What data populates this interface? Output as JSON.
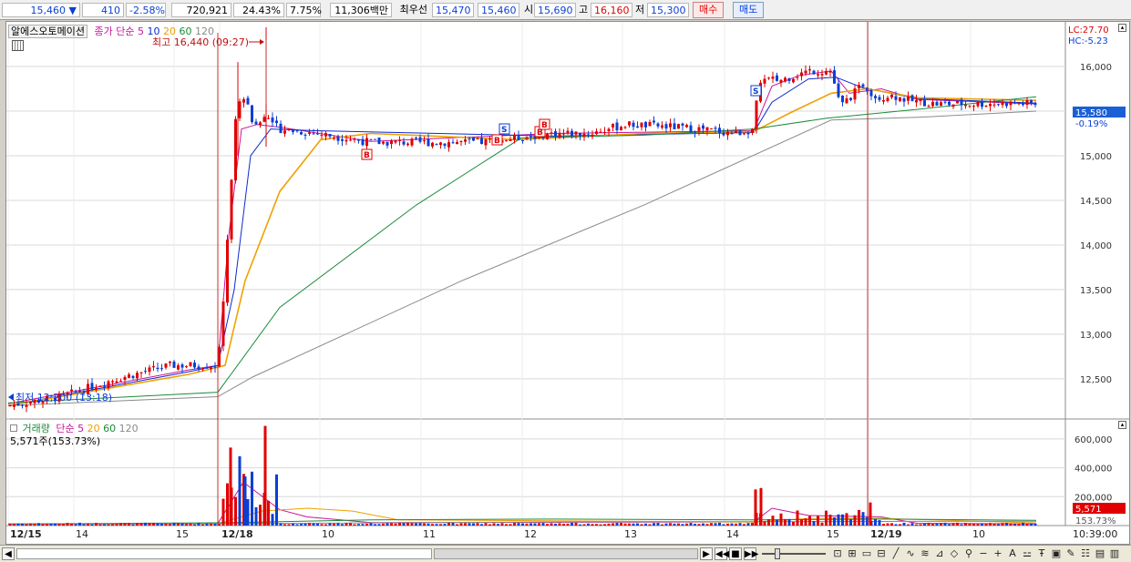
{
  "quote": {
    "price": "15,460",
    "direction": "▼",
    "change": "410",
    "change_pct": "-2.58%",
    "volume": "720,921",
    "turnover_rate": "24.43%",
    "ratio": "7.75%",
    "amount": "11,306백만",
    "best_bid_label": "최우선",
    "best_ask": "15,470",
    "best_bid": "15,460",
    "open_label": "시",
    "open": "15,690",
    "high_label": "고",
    "high": "16,160",
    "low_label": "저",
    "low": "15,300",
    "buy_button": "매수",
    "sell_button": "매도"
  },
  "price_pane": {
    "stock_name": "알에스오토메이션",
    "ma_title": "종가 단순",
    "ma_periods": [
      "5",
      "10",
      "20",
      "60",
      "120"
    ],
    "ma_colors": [
      "#c8149b",
      "#0a2bd0",
      "#f0a000",
      "#1a8c3a",
      "#8a8a8a"
    ],
    "high_annotation": "최고 16,440 (09:27)",
    "low_annotation": "최저 12,200 (13:18)",
    "lc_label": "LC:27.70",
    "hc_label": "HC:-5.23",
    "current_price_tag": "15,580",
    "current_change_tag": "-0.19%",
    "y_ticks": [
      "16,000",
      "15,500",
      "15,000",
      "14,500",
      "14,000",
      "13,500",
      "13,000",
      "12,500"
    ]
  },
  "volume_pane": {
    "title": "거래량",
    "ma_title": "단순",
    "ma_periods": [
      "5",
      "20",
      "60",
      "120"
    ],
    "ma_colors": [
      "#c8149b",
      "#f0a000",
      "#1a8c3a",
      "#8a8a8a"
    ],
    "current_volume": "5,571주(153.73%)",
    "y_ticks": [
      "600,000",
      "400,000",
      "200,000"
    ],
    "current_tag": "5,571",
    "current_pct_tag": "153.73%"
  },
  "x_axis": {
    "labels": [
      "12/15",
      "14",
      "15",
      "12/18",
      "10",
      "11",
      "12",
      "13",
      "14",
      "15",
      "12/19",
      "10"
    ],
    "time": "10:39:00"
  },
  "signals": [
    "B",
    "B",
    "S",
    "B",
    "B",
    "S"
  ],
  "colors": {
    "up": "#e00000",
    "down": "#0a3fd6",
    "grid": "#d8d8d8",
    "axis_text": "#333333"
  }
}
